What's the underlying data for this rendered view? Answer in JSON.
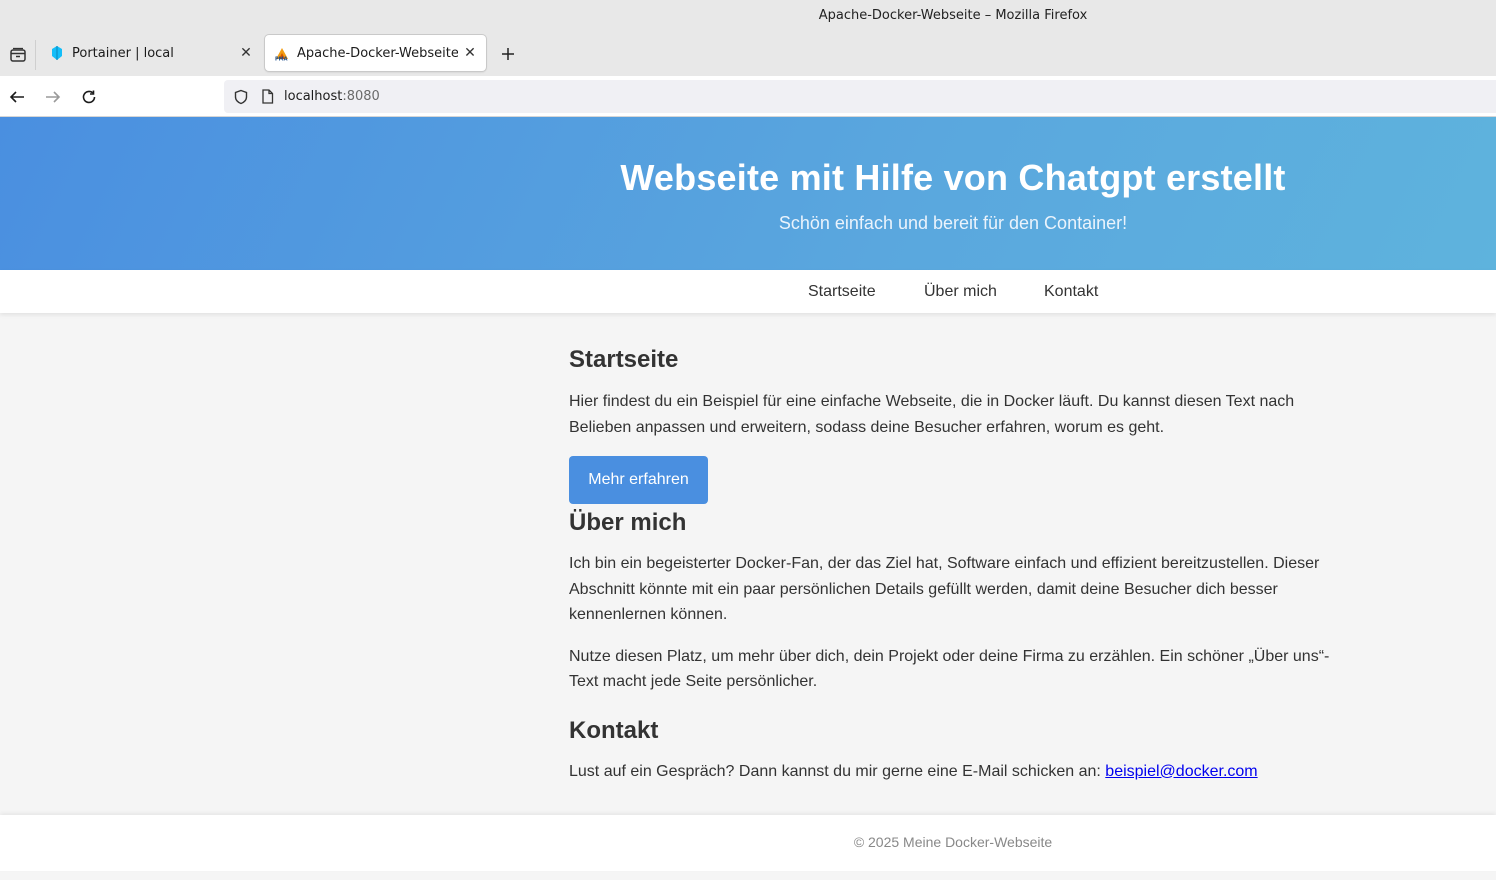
{
  "browser": {
    "window_title": "Apache-Docker-Webseite – Mozilla Firefox",
    "tabs": [
      {
        "label": "Portainer | local",
        "active": false
      },
      {
        "label": "Apache-Docker-Webseite",
        "active": true
      }
    ],
    "url": {
      "host": "localhost",
      "port": ":8080"
    }
  },
  "site": {
    "title": "Webseite mit Hilfe von Chatgpt erstellt",
    "subtitle": "Schön einfach und bereit für den Container!",
    "nav": [
      "Startseite",
      "Über mich",
      "Kontakt"
    ],
    "sections": {
      "start": {
        "heading": "Startseite",
        "text": "Hier findest du ein Beispiel für eine einfache Webseite, die in Docker läuft. Du kannst diesen Text nach Belieben anpassen und erweitern, sodass deine Besucher erfahren, worum es geht.",
        "button": "Mehr erfahren"
      },
      "about": {
        "heading": "Über mich",
        "text1": "Ich bin ein begeisterter Docker-Fan, der das Ziel hat, Software einfach und effizient bereitzustellen. Dieser Abschnitt könnte mit ein paar persönlichen Details gefüllt werden, damit deine Besucher dich besser kennenlernen können.",
        "text2": "Nutze diesen Platz, um mehr über dich, dein Projekt oder deine Firma zu erzählen. Ein schöner „Über uns“-Text macht jede Seite persönlicher."
      },
      "contact": {
        "heading": "Kontakt",
        "text": "Lust auf ein Gespräch? Dann kannst du mir gerne eine E-Mail schicken an: ",
        "email": "beispiel@docker.com"
      }
    },
    "footer": "© 2025 Meine Docker-Webseite"
  },
  "colors": {
    "hero_start": "#4a8fe0",
    "hero_end": "#5eb3dd",
    "button": "#4a8fe0",
    "link": "#0000ee"
  }
}
